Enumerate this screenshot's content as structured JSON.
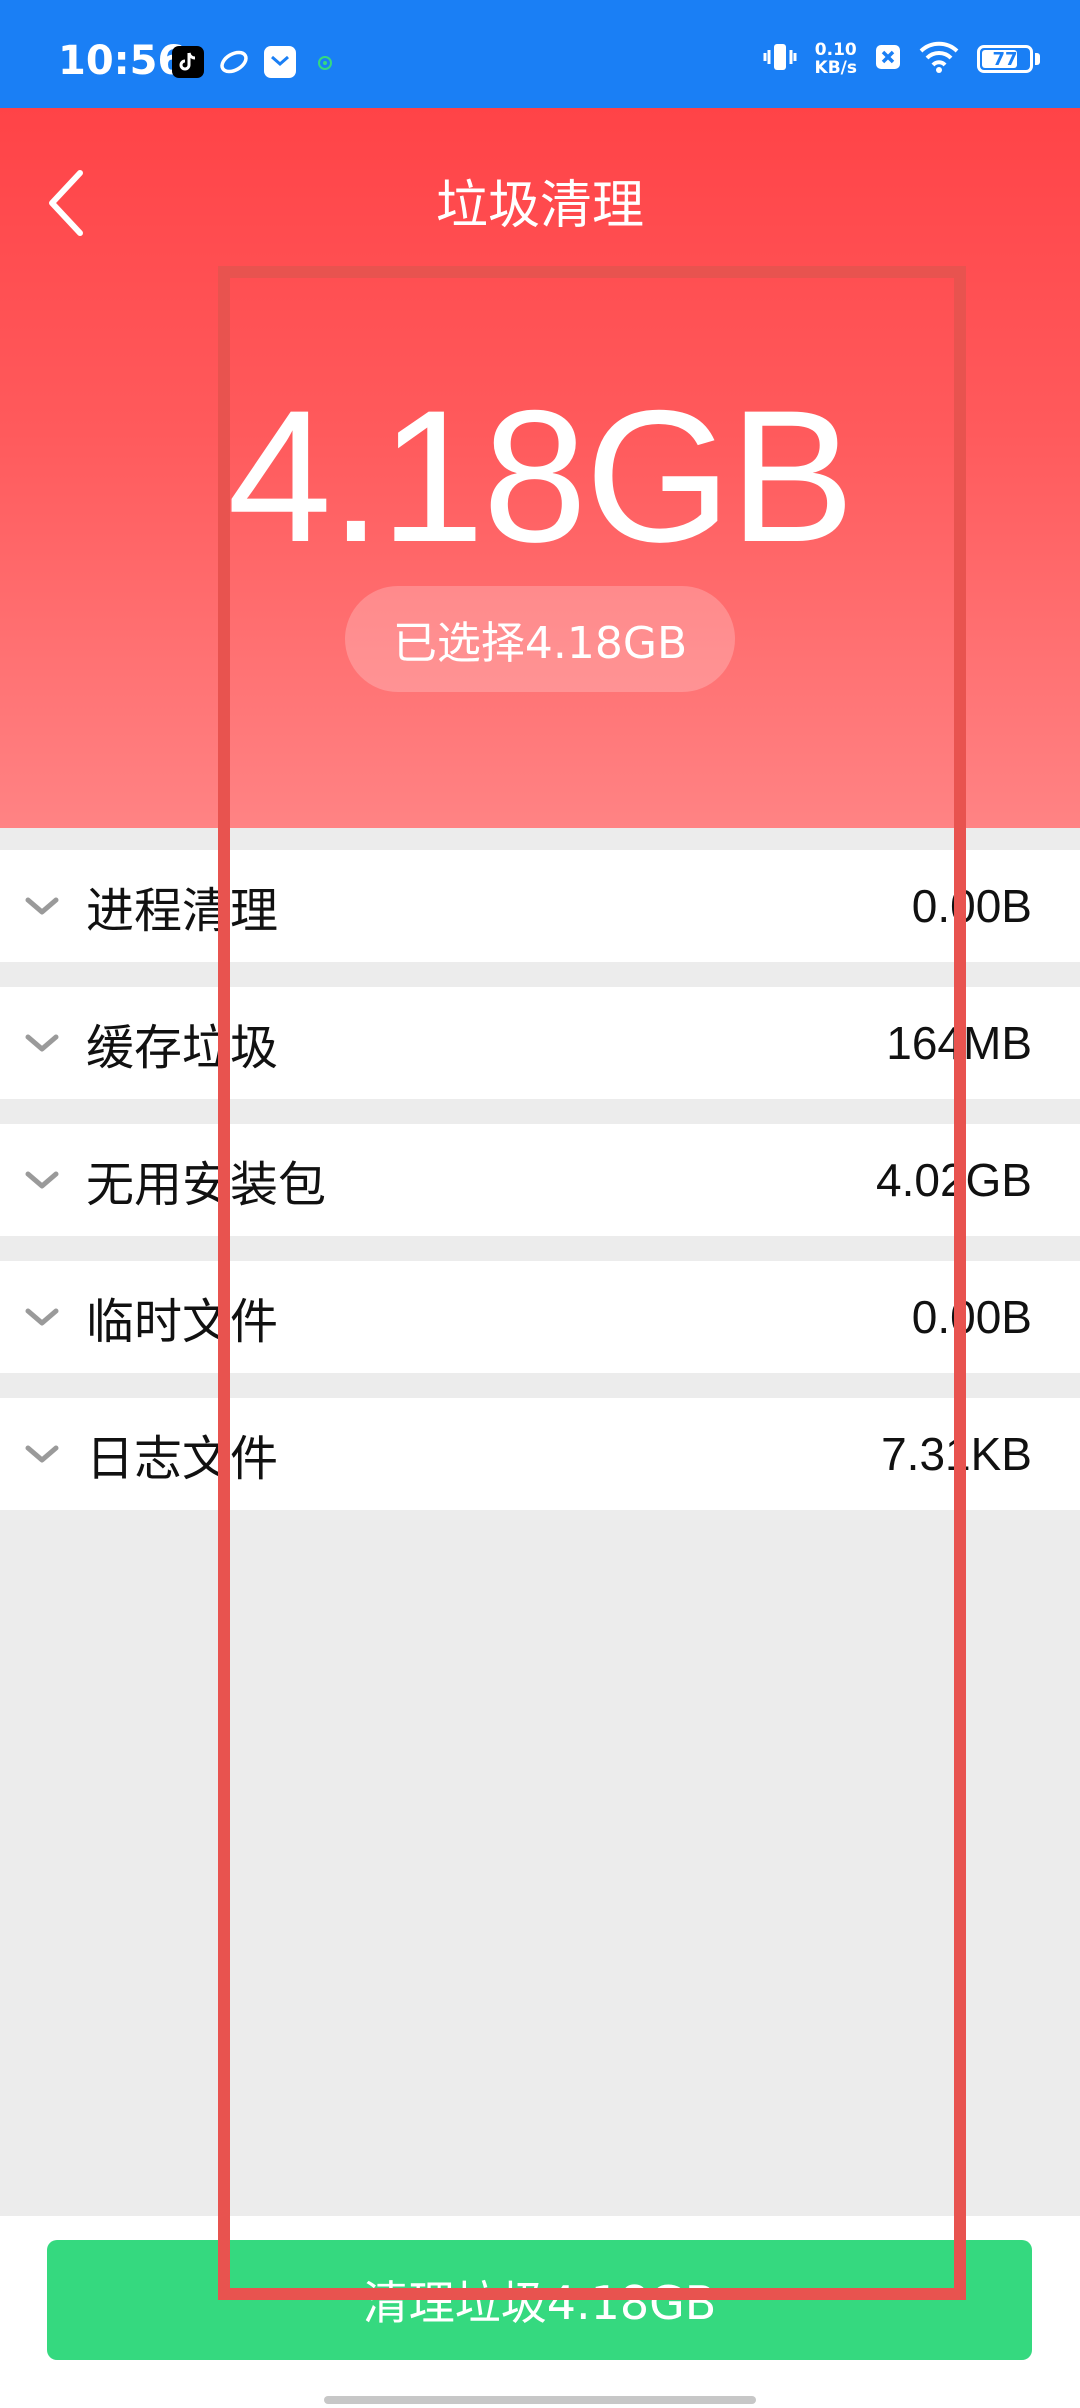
{
  "status_bar": {
    "time": "10:56",
    "net_speed_top": "0.10",
    "net_speed_bottom": "KB/s",
    "battery": "77",
    "battery_level_percent": 77,
    "icons": [
      "tiktok-icon",
      "link-icon",
      "mail-icon",
      "dot-icon",
      "vibrate-icon",
      "close-box-icon",
      "wifi-icon",
      "battery-icon"
    ]
  },
  "header": {
    "title": "垃圾清理",
    "total_size": "4.18GB",
    "selected_label": "已选择4.18GB",
    "back_icon": "chevron-left-icon"
  },
  "items": [
    {
      "label": "进程清理",
      "size": "0.00B"
    },
    {
      "label": "缓存垃圾",
      "size": "164MB"
    },
    {
      "label": "无用安装包",
      "size": "4.02GB"
    },
    {
      "label": "临时文件",
      "size": "0.00B"
    },
    {
      "label": "日志文件",
      "size": "7.31KB"
    }
  ],
  "action": {
    "clean_label": "清理垃圾4.18GB"
  },
  "colors": {
    "status_bar": "#1a7ff5",
    "header_top": "#ff4347",
    "header_bottom": "#ff8384",
    "button": "#35d97f",
    "overlay_frame": "#e8534f"
  }
}
